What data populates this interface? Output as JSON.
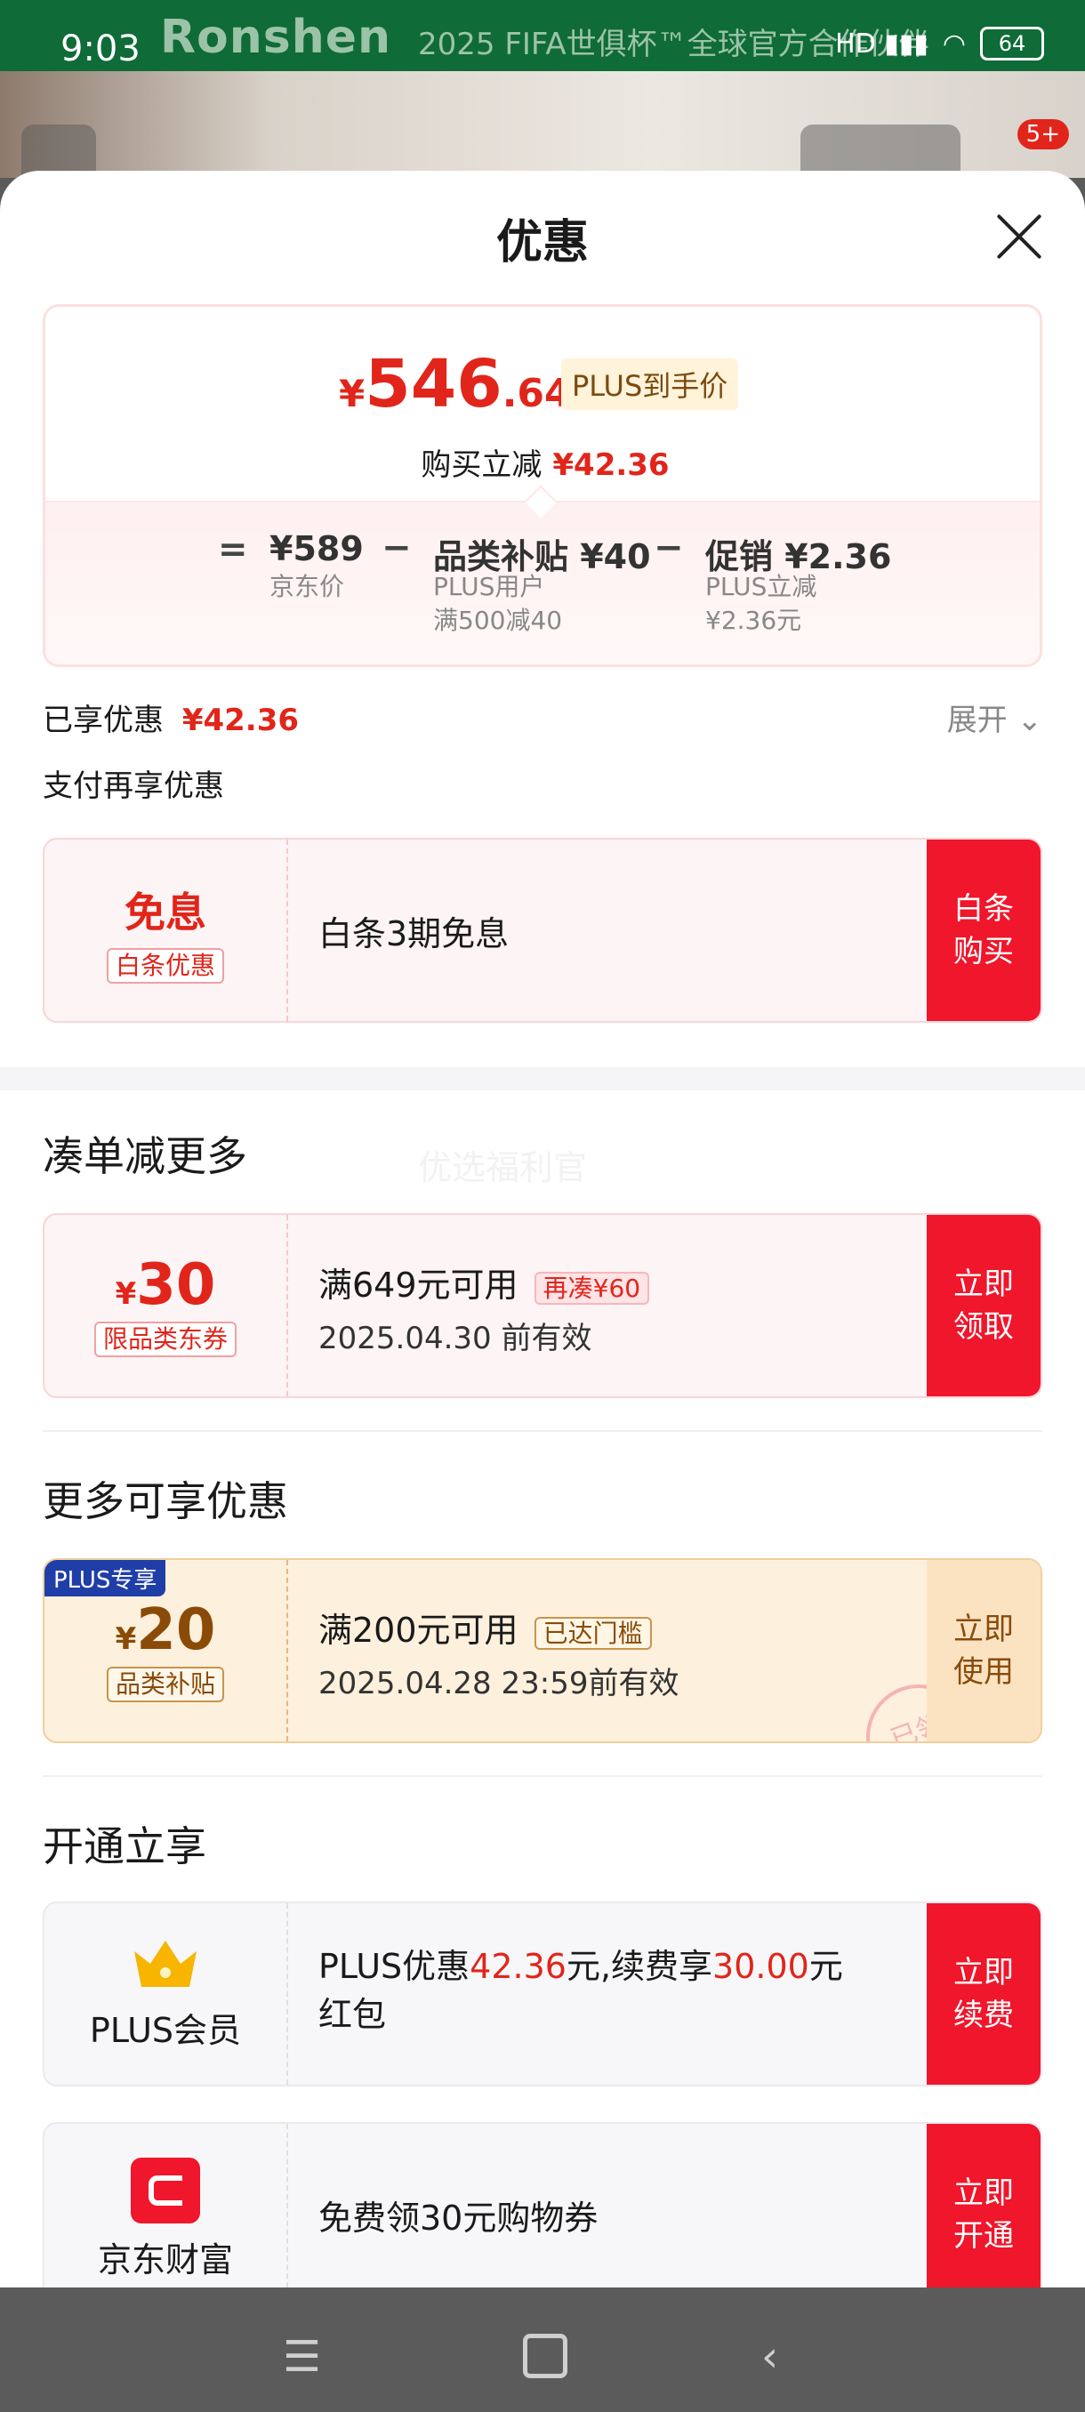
{
  "status": {
    "time": "9:03",
    "hd": "HD",
    "battery": "64"
  },
  "background": {
    "brand": "Ronshen",
    "banner_text": "2025 FIFA世俱杯™全球官方合作伙伴",
    "badge": "5+"
  },
  "sheet": {
    "title": "优惠"
  },
  "price": {
    "currency": "¥",
    "integer": "546",
    "decimal": ".64",
    "plus_tag": "PLUS到手价",
    "reduce_label": "购买立减",
    "reduce_value": "¥42.36",
    "eq": "=",
    "jd_price": "¥589",
    "jd_price_label": "京东价",
    "minus1": "−",
    "subsidy_title": "品类补贴 ¥40",
    "subsidy_sub1": "PLUS用户",
    "subsidy_sub2": "满500减40",
    "minus2": "−",
    "promo_title": "促销 ¥2.36",
    "promo_sub1": "PLUS立减",
    "promo_sub2": "¥2.36元"
  },
  "enjoyed": {
    "label": "已享优惠",
    "value": "¥42.36",
    "expand": "展开"
  },
  "pay_more": {
    "label": "支付再享优惠"
  },
  "baitiao": {
    "title": "免息",
    "tag": "白条优惠",
    "desc": "白条3期免息",
    "button": "白条\n购买"
  },
  "watermark": "优选福利官",
  "section1": {
    "title": "凑单减更多",
    "coupon": {
      "currency": "¥",
      "amount": "30",
      "tag": "限品类东券",
      "desc": "满649元可用",
      "badge": "再凑¥60",
      "validity": "2025.04.30 前有效",
      "button": "立即\n领取"
    }
  },
  "section2": {
    "title": "更多可享优惠",
    "coupon": {
      "plus_corner": "PLUS专享",
      "currency": "¥",
      "amount": "20",
      "tag": "品类补贴",
      "desc": "满200元可用",
      "badge": "已达门槛",
      "validity": "2025.04.28 23:59前有效",
      "button": "立即\n使用",
      "stamp": "已领"
    }
  },
  "section3": {
    "title": "开通立享",
    "plus": {
      "name": "PLUS会员",
      "desc_a": "PLUS优惠",
      "desc_b": "42.36",
      "desc_c": "元,续费享",
      "desc_d": "30.00",
      "desc_e": "元",
      "desc_f": "红包",
      "button": "立即\n续费"
    },
    "finance": {
      "name": "京东财富",
      "desc": "免费领30元购物券",
      "button": "立即\n开通"
    }
  },
  "colors": {
    "accent": "#e1251b",
    "button": "#f0162b",
    "plus_gold": "#7a4b10"
  }
}
